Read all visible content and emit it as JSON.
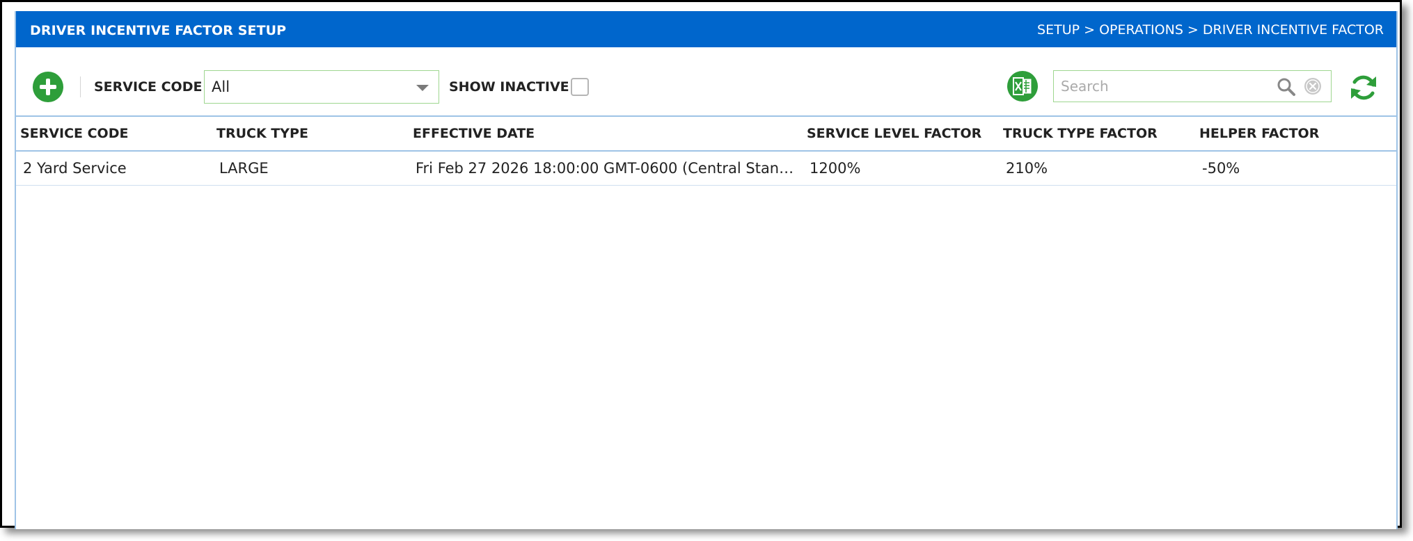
{
  "header": {
    "title": "DRIVER INCENTIVE FACTOR SETUP",
    "breadcrumb": "SETUP > OPERATIONS > DRIVER INCENTIVE FACTOR"
  },
  "toolbar": {
    "service_code_label": "SERVICE CODE",
    "service_code_value": "All",
    "show_inactive_label": "SHOW INACTIVE",
    "search_placeholder": "Search",
    "icons": {
      "add": "plus-icon",
      "export": "excel-icon",
      "search": "search-icon",
      "clear": "clear-icon",
      "refresh": "refresh-icon"
    }
  },
  "grid": {
    "columns": [
      "SERVICE CODE",
      "TRUCK TYPE",
      "EFFECTIVE DATE",
      "SERVICE LEVEL FACTOR",
      "TRUCK TYPE FACTOR",
      "HELPER FACTOR"
    ],
    "rows": [
      [
        "2 Yard Service",
        "LARGE",
        "Fri Feb 27 2026 18:00:00 GMT-0600 (Central Standa…",
        "1200%",
        "210%",
        "-50%"
      ]
    ]
  },
  "colors": {
    "header_bg": "#0066cc",
    "accent_green": "#2e9e3a",
    "input_border": "#9ed68f",
    "grid_border": "#9ec3e6"
  }
}
